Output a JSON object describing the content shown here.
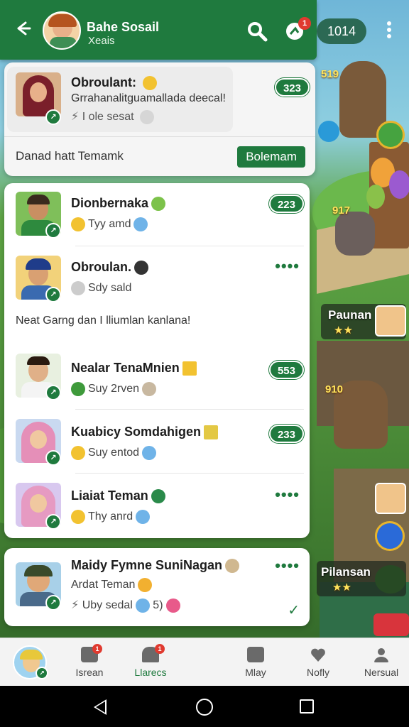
{
  "header": {
    "title": "Bahe Sosail",
    "subtitle": "Xeais",
    "chat_badge": "1",
    "coins": "1014"
  },
  "pinned": {
    "name": "Obroulant:",
    "message": "Grrahanalitguamallada deecal!",
    "line3": "I ole sesat",
    "count": "323",
    "footer_text": "Danad hatt Temamk",
    "action_label": "Bolemam"
  },
  "chats": [
    {
      "name": "Dionbernaka",
      "preview": "Tyy amd",
      "count": "223",
      "emoji_color": "#7cc24a",
      "emoji2_color": "#6fb3e8"
    },
    {
      "name": "Obroulan.",
      "preview": "Sdy sald",
      "count": "••••",
      "emoji_color": "#333333",
      "emoji2_color": "#cccccc"
    },
    {
      "name": "Nealar TenaMnien",
      "preview": "Suy 2rven",
      "count": "553",
      "emoji_color": "#f2c230",
      "emoji2_color": "#3e9a3b"
    },
    {
      "name": "Kuabicy Somdahigen",
      "preview": "Suy entod",
      "count": "233",
      "emoji_color": "#e3c844",
      "emoji2_color": "#6fb3e8"
    },
    {
      "name": "Liaiat Teman",
      "preview": "Thy anrd",
      "count": "••••",
      "emoji_color": "#2a8a4a",
      "emoji2_color": "#6fb3e8"
    }
  ],
  "note": "Neat  Garng dan I lliumlan kanlana!",
  "last_chat": {
    "name": "Maidy Fymne SuniNagan",
    "message": "Ardat Teman",
    "line3": "Uby sedal",
    "line3_suffix": "5)",
    "dots": "••••"
  },
  "game": {
    "score_top": "519",
    "score_mid": "917",
    "score_low": "910",
    "label_1": "Paunan",
    "label_2": "Pilansan",
    "stars": "★★"
  },
  "nav": [
    {
      "label": "Isrean"
    },
    {
      "label": "Llarecs"
    },
    {
      "label": "Mlay"
    },
    {
      "label": "Nofly"
    },
    {
      "label": "Nersual"
    }
  ],
  "colors": {
    "accent": "#1f7a3e",
    "badge": "#e03a2f"
  }
}
